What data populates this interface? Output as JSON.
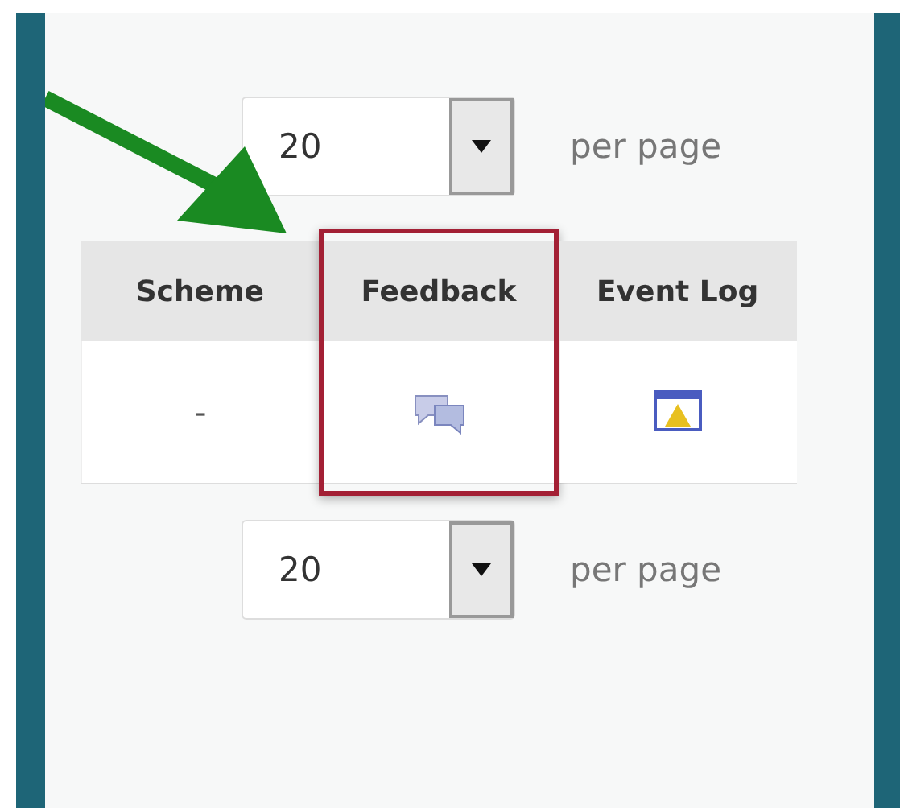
{
  "top_pager": {
    "value": "20",
    "label": "per page"
  },
  "table": {
    "columns": [
      {
        "label": "Scheme",
        "highlighted": false,
        "cell": {
          "kind": "text",
          "text": "-"
        }
      },
      {
        "label": "Feedback",
        "highlighted": true,
        "cell": {
          "kind": "chat"
        }
      },
      {
        "label": "Event Log",
        "highlighted": false,
        "cell": {
          "kind": "warning"
        }
      }
    ]
  },
  "bottom_pager": {
    "value": "20",
    "label": "per page"
  }
}
